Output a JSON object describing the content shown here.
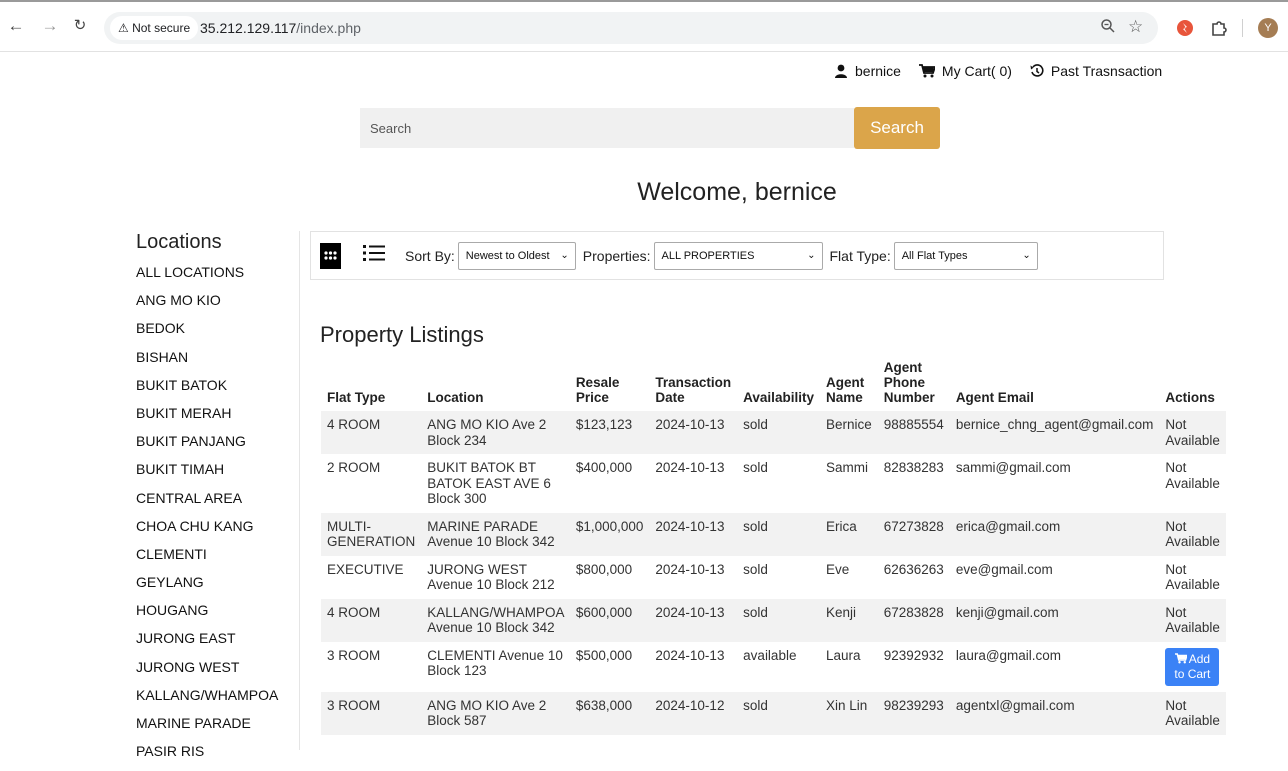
{
  "browser": {
    "security_label": "Not secure",
    "url_host": "35.212.129.117",
    "url_path": "/index.php"
  },
  "userbar": {
    "username": "bernice",
    "cart_label": "My Cart( 0)",
    "past_label": "Past Trasnsaction"
  },
  "search": {
    "placeholder": "Search",
    "button_label": "Search"
  },
  "welcome": "Welcome, bernice",
  "sidebar": {
    "title": "Locations",
    "items": [
      "ALL LOCATIONS",
      "ANG MO KIO",
      "BEDOK",
      "BISHAN",
      "BUKIT BATOK",
      "BUKIT MERAH",
      "BUKIT PANJANG",
      "BUKIT TIMAH",
      "CENTRAL AREA",
      "CHOA CHU KANG",
      "CLEMENTI",
      "GEYLANG",
      "HOUGANG",
      "JURONG EAST",
      "JURONG WEST",
      "KALLANG/WHAMPOA",
      "MARINE PARADE",
      "PASIR RIS"
    ]
  },
  "filters": {
    "sort_label": "Sort By:",
    "sort_value": "Newest to Oldest",
    "properties_label": "Properties:",
    "properties_value": "ALL PROPERTIES",
    "flat_type_label": "Flat Type:",
    "flat_type_value": "All Flat Types"
  },
  "listing_title": "Property Listings",
  "table": {
    "headers": {
      "flat_type": "Flat Type",
      "location": "Location",
      "resale_price_1": "Resale",
      "resale_price_2": "Price",
      "transaction_date_1": "Transaction",
      "transaction_date_2": "Date",
      "availability": "Availability",
      "agent_name_1": "Agent",
      "agent_name_2": "Name",
      "agent_phone_1": "Agent",
      "agent_phone_2": "Phone",
      "agent_phone_3": "Number",
      "agent_email": "Agent Email",
      "actions": "Actions"
    },
    "rows": [
      {
        "flat_type": "4 ROOM",
        "location": "ANG MO KIO Ave 2 Block 234",
        "price": "$123,123",
        "date": "2024-10-13",
        "availability": "sold",
        "agent": "Bernice",
        "phone": "98885554",
        "email": "bernice_chng_agent@gmail.com",
        "action": "Not Available"
      },
      {
        "flat_type": "2 ROOM",
        "location": "BUKIT BATOK BT BATOK EAST AVE 6 Block 300",
        "price": "$400,000",
        "date": "2024-10-13",
        "availability": "sold",
        "agent": "Sammi",
        "phone": "82838283",
        "email": "sammi@gmail.com",
        "action": "Not Available"
      },
      {
        "flat_type": "MULTI-GENERATION",
        "location": "MARINE PARADE Avenue 10 Block 342",
        "price": "$1,000,000",
        "date": "2024-10-13",
        "availability": "sold",
        "agent": "Erica",
        "phone": "67273828",
        "email": "erica@gmail.com",
        "action": "Not Available"
      },
      {
        "flat_type": "EXECUTIVE",
        "location": "JURONG WEST Avenue 10 Block 212",
        "price": "$800,000",
        "date": "2024-10-13",
        "availability": "sold",
        "agent": "Eve",
        "phone": "62636263",
        "email": "eve@gmail.com",
        "action": "Not Available"
      },
      {
        "flat_type": "4 ROOM",
        "location": "KALLANG/WHAMPOA Avenue 10 Block 342",
        "price": "$600,000",
        "date": "2024-10-13",
        "availability": "sold",
        "agent": "Kenji",
        "phone": "67283828",
        "email": "kenji@gmail.com",
        "action": "Not Available"
      },
      {
        "flat_type": "3 ROOM",
        "location": "CLEMENTI Avenue 10 Block 123",
        "price": "$500,000",
        "date": "2024-10-13",
        "availability": "available",
        "agent": "Laura",
        "phone": "92392932",
        "email": "laura@gmail.com",
        "action": "Add to Cart"
      },
      {
        "flat_type": "3 ROOM",
        "location": "ANG MO KIO Ave 2 Block 587",
        "price": "$638,000",
        "date": "2024-10-12",
        "availability": "sold",
        "agent": "Xin Lin",
        "phone": "98239293",
        "email": "agentxl@gmail.com",
        "action": "Not Available"
      }
    ]
  }
}
